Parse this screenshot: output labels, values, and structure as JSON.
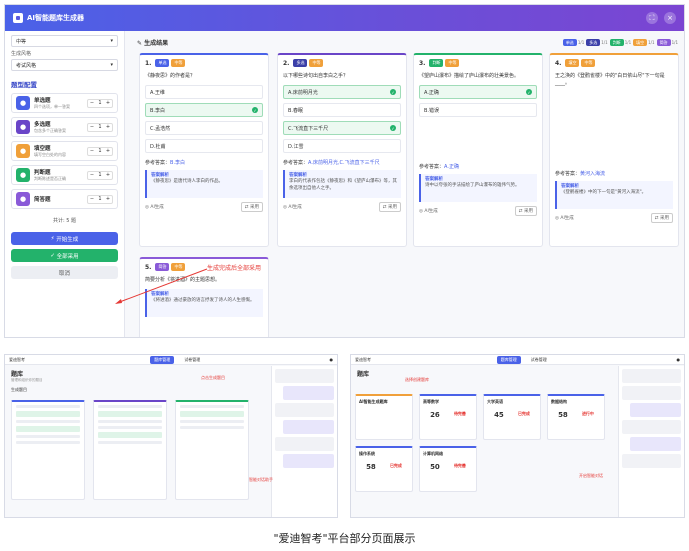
{
  "app": {
    "title": "AI智能题库生成器"
  },
  "sidebar": {
    "field1": {
      "label": "",
      "value": "中等"
    },
    "field2": {
      "label": "生成风格",
      "value": "考试风格"
    },
    "section_title": "题型配置",
    "types": [
      {
        "name": "单选题",
        "desc": "四个选项，单一答案",
        "count": "1",
        "color": "#4a62e8"
      },
      {
        "name": "多选题",
        "desc": "包含多个正确答案",
        "count": "1",
        "color": "#6a45c8"
      },
      {
        "name": "填空题",
        "desc": "填写空白处的内容",
        "count": "1",
        "color": "#f0a03a"
      },
      {
        "name": "判断题",
        "desc": "判断陈述是否正确",
        "count": "1",
        "color": "#23b26b"
      },
      {
        "name": "简答题",
        "desc": "",
        "count": "1",
        "color": "#8a5ad8"
      }
    ],
    "total": "共计: 5 题",
    "btn_generate": "开始生成",
    "btn_adopt": "全部采用",
    "btn_cancel": "取消"
  },
  "results": {
    "title": "生成结果",
    "filters": [
      {
        "label": "单选",
        "n": "1/1",
        "color": "#4a62e8"
      },
      {
        "label": "多选",
        "n": "1/1",
        "color": "#3b3fa8"
      },
      {
        "label": "判断",
        "n": "1/1",
        "color": "#23b26b"
      },
      {
        "label": "填空",
        "n": "1/1",
        "color": "#f0a03a"
      },
      {
        "label": "简答",
        "n": "1/1",
        "color": "#8a5ad8"
      }
    ],
    "cards": [
      {
        "no": "1.",
        "type": "单选",
        "level": "中等",
        "type_color": "#4a62e8",
        "border": "#4a62e8",
        "question": "《静夜思》的作者是？",
        "options": [
          {
            "t": "A.王维",
            "ok": false
          },
          {
            "t": "B.李白",
            "ok": true
          },
          {
            "t": "C.孟浩然",
            "ok": false
          },
          {
            "t": "D.杜甫",
            "ok": false
          }
        ],
        "answer_label": "参考答案：",
        "answer": "B.李白",
        "explain_title": "答案解析",
        "explain": "《静夜思》是唐代诗人李白的作品。",
        "source": "AI生成",
        "adopt": "采用"
      },
      {
        "no": "2.",
        "type": "多选",
        "level": "中等",
        "type_color": "#3b3fa8",
        "border": "#6a45c8",
        "question": "以下哪些诗句出自李白之手？",
        "options": [
          {
            "t": "A.床前明月光",
            "ok": true
          },
          {
            "t": "B.春眠",
            "ok": false
          },
          {
            "t": "C.飞流直下三千尺",
            "ok": true
          },
          {
            "t": "D.江雪",
            "ok": false
          }
        ],
        "answer_label": "参考答案：",
        "answer": "A.床前明月光,C.飞流直下三千尺",
        "explain_title": "答案解析",
        "explain": "李白的代表作包括《静夜思》和《望庐山瀑布》等，其余选项出自他人之手。",
        "source": "AI生成",
        "adopt": "采用"
      },
      {
        "no": "3.",
        "type": "判断",
        "level": "中等",
        "type_color": "#23b26b",
        "border": "#23b26b",
        "question": "《望庐山瀑布》描绘了庐山瀑布的壮美景色。",
        "options": [
          {
            "t": "A.正确",
            "ok": true
          },
          {
            "t": "B.错误",
            "ok": false
          }
        ],
        "answer_label": "参考答案：",
        "answer": "A.正确",
        "explain_title": "答案解析",
        "explain": "诗中以夸张的手法描绘了庐山瀑布的雄伟气势。",
        "source": "AI生成",
        "adopt": "采用"
      },
      {
        "no": "4.",
        "type": "填空",
        "level": "中等",
        "type_color": "#f0a03a",
        "border": "#f0a03a",
        "question": "王之涣的《登鹳雀楼》中的\"白日依山尽\"下一句是____。",
        "options": [],
        "answer_label": "参考答案：",
        "answer": "黄河入海流",
        "explain_title": "答案解析",
        "explain": "《登鹳雀楼》中的下一句是\"黄河入海流\"。",
        "source": "AI生成",
        "adopt": "采用"
      }
    ],
    "card5": {
      "no": "5.",
      "type": "简答",
      "level": "中等",
      "type_color": "#8a5ad8",
      "question": "简要分析《将进酒》的主题思想。",
      "explain_title": "答案解析",
      "explain": "《将进酒》通过豪放的语言抒发了诗人的人生感慨。"
    }
  },
  "annotations": {
    "main": "生成完成后全部采用",
    "left1": "点击生成题目",
    "left2": "智能对话助手",
    "right1": "选择创建题库",
    "right2": "开启智能对话"
  },
  "left_shot": {
    "brand": "爱迪智考",
    "tab_active": "题库管理",
    "tab2": "试卷管理",
    "title": "题库",
    "subtitle": "管理和组织你的题目",
    "section": "生成题目"
  },
  "right_shot": {
    "brand": "爱迪智考",
    "tab_active": "题库管理",
    "tab2": "试卷管理",
    "title": "题库",
    "create_card": "AI智能生成题库",
    "cards": [
      {
        "t": "高等数学",
        "a": "26",
        "b": "待完善"
      },
      {
        "t": "大学英语",
        "a": "45",
        "b": "已完成"
      },
      {
        "t": "数据结构",
        "a": "58",
        "b": "进行中"
      },
      {
        "t": "操作系统",
        "a": "58",
        "b": "已完成"
      },
      {
        "t": "计算机网络",
        "a": "50",
        "b": "待完善"
      }
    ]
  },
  "caption": "\"爱迪智考\"平台部分页面展示"
}
